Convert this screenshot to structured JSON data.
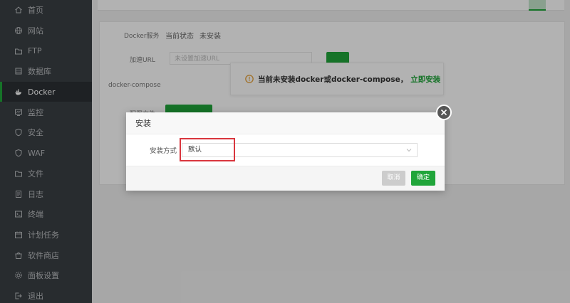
{
  "sidebar": {
    "items": [
      {
        "label": "首页",
        "icon": "home-icon"
      },
      {
        "label": "网站",
        "icon": "globe-icon"
      },
      {
        "label": "FTP",
        "icon": "folder-icon"
      },
      {
        "label": "数据库",
        "icon": "database-icon"
      },
      {
        "label": "Docker",
        "icon": "docker-icon",
        "active": true
      },
      {
        "label": "监控",
        "icon": "monitor-icon"
      },
      {
        "label": "安全",
        "icon": "shield-icon"
      },
      {
        "label": "WAF",
        "icon": "shield-icon"
      },
      {
        "label": "文件",
        "icon": "folder-icon"
      },
      {
        "label": "日志",
        "icon": "log-icon"
      },
      {
        "label": "终端",
        "icon": "terminal-icon"
      },
      {
        "label": "计划任务",
        "icon": "calendar-icon"
      },
      {
        "label": "软件商店",
        "icon": "store-icon"
      },
      {
        "label": "面板设置",
        "icon": "gear-icon"
      },
      {
        "label": "退出",
        "icon": "logout-icon"
      }
    ]
  },
  "panel": {
    "docker_service_label": "Docker服务",
    "status_label": "当前状态",
    "status_value": "未安装",
    "accelerator_label": "加速URL",
    "accelerator_placeholder": "未设置加速URL",
    "compose_label": "docker-compose",
    "config_label": "配置文件"
  },
  "warning": {
    "text": "当前未安装docker或docker-compose，",
    "link": "立即安装"
  },
  "dialog": {
    "title": "安装",
    "field_label": "安装方式",
    "select_value": "默认",
    "cancel_label": "取消",
    "ok_label": "确定"
  },
  "colors": {
    "accent": "#20a53a",
    "sidebar_bg": "#3a3f44",
    "highlight": "#d9363e"
  }
}
